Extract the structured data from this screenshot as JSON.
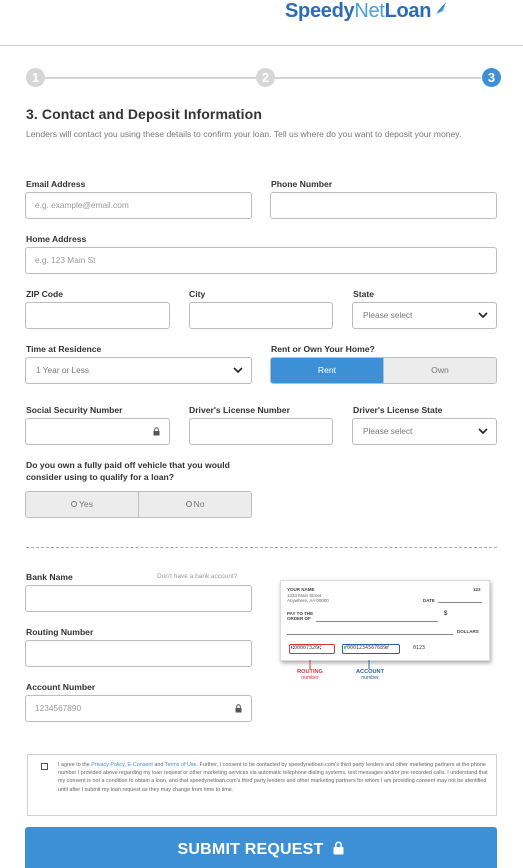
{
  "brand": {
    "name_part1": "Speedy",
    "name_part2": "Net",
    "name_part3": "Loan",
    "primary_color": "#2b6cb8",
    "accent_color": "#3d8fd6"
  },
  "progress": {
    "steps": [
      "1",
      "2",
      "3"
    ],
    "current_step": 3
  },
  "section": {
    "title": "3. Contact and Deposit Information",
    "intro": "Lenders will contact you using these details to confirm your loan. Tell us where do you want to deposit your money."
  },
  "fields": {
    "email": {
      "label": "Email Address",
      "placeholder": "e.g. example@email.com"
    },
    "phone": {
      "label": "Phone Number",
      "placeholder": ""
    },
    "home_address": {
      "label": "Home Address",
      "placeholder": "e.g. 123 Main St"
    },
    "zip": {
      "label": "ZIP Code",
      "placeholder": ""
    },
    "city": {
      "label": "City",
      "placeholder": ""
    },
    "state": {
      "label": "State",
      "value": "Please select"
    },
    "time_at_residence": {
      "label": "Time at Residence",
      "value": "1 Year or Less"
    },
    "rent_or_own": {
      "label": "Rent or Own Your Home?",
      "options": [
        "Rent",
        "Own"
      ],
      "selected": "Rent"
    },
    "ssn": {
      "label": "Social Security Number",
      "placeholder": ""
    },
    "dl_number": {
      "label": "Driver's License Number",
      "placeholder": ""
    },
    "dl_state": {
      "label": "Driver's License State",
      "value": "Please select"
    },
    "vehicle": {
      "question": "Do you own a fully paid off vehicle that you would consider using to qualify for a loan?",
      "options": [
        "Yes",
        "No"
      ]
    },
    "bank_name": {
      "label": "Bank Name",
      "hint": "Don't have a bank account?",
      "placeholder": ""
    },
    "routing": {
      "label": "Routing Number",
      "placeholder": ""
    },
    "account": {
      "label": "Account Number",
      "placeholder": "1234567890"
    }
  },
  "check_sample": {
    "your_name": "YOUR NAME",
    "address_line1": "1234 Main Street",
    "address_line2": "Anywhere, AA 00000",
    "check_number": "123",
    "date_label": "DATE",
    "pay_to_line1": "PAY TO THE",
    "pay_to_line2": "ORDER OF",
    "dollar_sign": "$",
    "dollars_label": "DOLLARS",
    "routing_digits": "⑆00007326⑆",
    "account_digits": "⑈0001234567689⑈",
    "check_digits": "0123",
    "routing_caption": "ROUTING",
    "routing_caption_sub": "number",
    "account_caption": "ACCOUNT",
    "account_caption_sub": "number",
    "routing_color": "#d8353d",
    "account_color": "#2b5fae"
  },
  "consent": {
    "text_before": "I agree to the ",
    "privacy_link": "Privacy Policy",
    "comma": ", ",
    "econsent_link": "E-Consent",
    "and": " and ",
    "terms_link": "Terms of Use",
    "text_after": ". Further, I consent to be contacted by speedynetloan.com's third party lenders and other marketing partners at the phone number I provided above regarding my loan request or other marketing services via automatic telephone dialing systems, text messages and/or pre-recorded calls. I understand that my consent is not a condition to obtain a loan, and that speedynetloan.com's third party lenders and other marketing partners for whom I am providing consent may not be identified until after I submit my loan request as they may change from time to time."
  },
  "submit": {
    "label": "SUBMIT REQUEST",
    "icon": "lock-icon"
  }
}
